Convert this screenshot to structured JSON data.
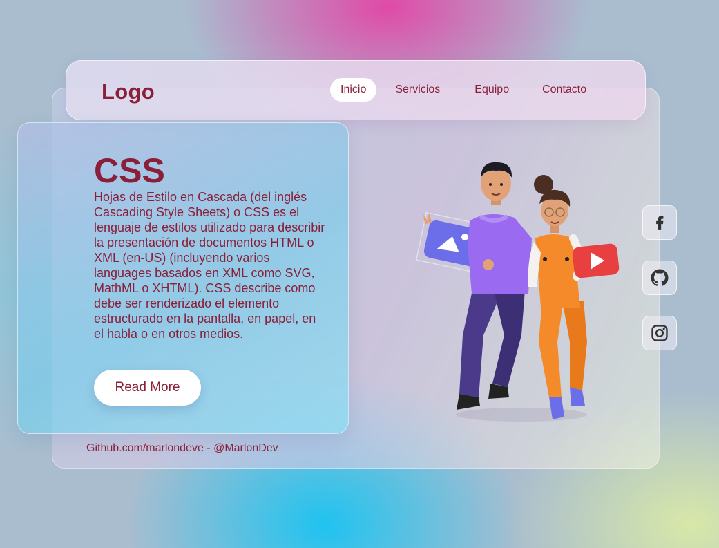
{
  "brand": {
    "logo": "Logo",
    "color": "#8a1f3a"
  },
  "nav": {
    "items": [
      {
        "label": "Inicio",
        "active": true
      },
      {
        "label": "Servicios",
        "active": false
      },
      {
        "label": "Equipo",
        "active": false
      },
      {
        "label": "Contacto",
        "active": false
      }
    ]
  },
  "hero": {
    "title": "CSS",
    "body": "Hojas de Estilo en Cascada (del inglés Cascading Style Sheets) o CSS es el lenguaje de estilos utilizado para describir la presentación de documentos HTML o XML (en-US) (incluyendo varios languages basados en XML como SVG, MathML o XHTML). CSS describe como debe ser renderizado el elemento estructurado en la pantalla, en papel, en el habla o en otros medios.",
    "button_label": "Read More"
  },
  "footer": {
    "credit": "Github.com/marlondeve - @MarlonDev"
  },
  "social": [
    {
      "icon": "facebook-icon"
    },
    {
      "icon": "github-icon"
    },
    {
      "icon": "instagram-icon"
    }
  ]
}
